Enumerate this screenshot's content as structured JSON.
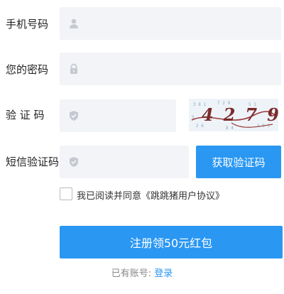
{
  "form": {
    "phone_label": "手机号码",
    "password_label": "您的密码",
    "captcha_label": "验 证 码",
    "sms_label": "短信验证码",
    "phone_value": "",
    "password_value": "",
    "captcha_value": "",
    "sms_value": ""
  },
  "captcha": {
    "text": "4279"
  },
  "buttons": {
    "get_sms": "获取验证码",
    "submit": "注册领50元红包"
  },
  "agreement": {
    "prefix": "我已阅读并同意",
    "link": "《跳跳猪用户协议》",
    "checked": false
  },
  "footer": {
    "have_account": "已有账号:",
    "login": "登录"
  },
  "colors": {
    "accent": "#2a97f3",
    "field_bg": "#f3f4f7"
  }
}
